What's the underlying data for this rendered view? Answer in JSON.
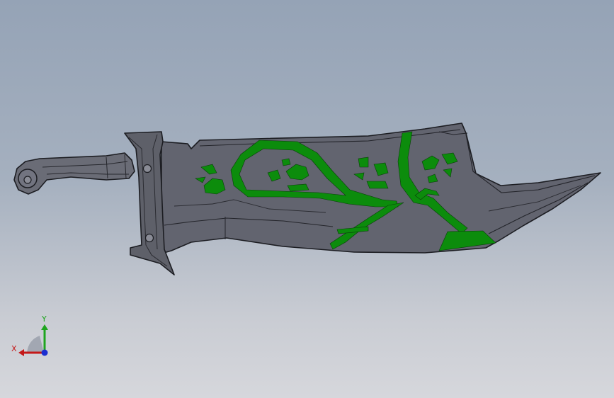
{
  "viewport": {
    "background_top": "#95a3b6",
    "background_bottom": "#d6d7dc"
  },
  "model": {
    "blade_color": "#62646f",
    "edge_color": "#1c1d22",
    "pattern_color": "#0c8c0c",
    "guard_color": "#5e6069"
  },
  "triad": {
    "y_label": "Y",
    "x_label": "X",
    "y_color": "#1ea51e",
    "x_color": "#c41818",
    "z_color": "#1b2ed0"
  }
}
